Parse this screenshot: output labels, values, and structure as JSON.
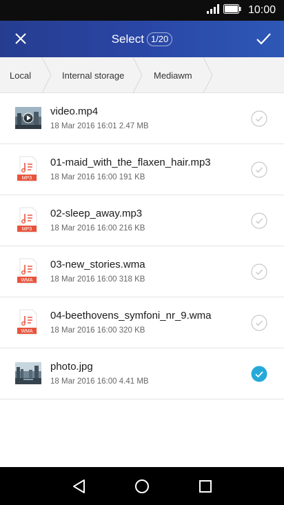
{
  "status": {
    "time": "10:00"
  },
  "header": {
    "title": "Select",
    "count": "1/20",
    "close_icon": "close-icon",
    "confirm_icon": "check-icon"
  },
  "breadcrumb": [
    {
      "label": "Local"
    },
    {
      "label": "Internal storage"
    },
    {
      "label": "Mediawm"
    }
  ],
  "files": [
    {
      "name": "video.mp4",
      "meta": "18 Mar 2016 16:01 2.47 MB",
      "kind": "video",
      "selected": false
    },
    {
      "name": "01-maid_with_the_flaxen_hair.mp3",
      "meta": "18 Mar 2016 16:00 191 KB",
      "kind": "audio",
      "badge": "MP3",
      "selected": false
    },
    {
      "name": "02-sleep_away.mp3",
      "meta": "18 Mar 2016 16:00 216 KB",
      "kind": "audio",
      "badge": "MP3",
      "selected": false
    },
    {
      "name": "03-new_stories.wma",
      "meta": "18 Mar 2016 16:00 318 KB",
      "kind": "audio",
      "badge": "WMA",
      "selected": false
    },
    {
      "name": "04-beethovens_symfoni_nr_9.wma",
      "meta": "18 Mar 2016 16:00 320 KB",
      "kind": "audio",
      "badge": "WMA",
      "selected": false
    },
    {
      "name": "photo.jpg",
      "meta": "18 Mar 2016 16:00 4.41 MB",
      "kind": "image",
      "selected": true
    }
  ],
  "colors": {
    "accent": "#26a9d9",
    "audio_badge": "#e8533c",
    "header_start": "#263d8f",
    "header_end": "#2e58b6"
  }
}
